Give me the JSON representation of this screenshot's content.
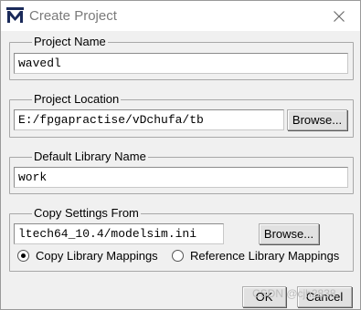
{
  "window": {
    "title": "Create Project"
  },
  "project_name": {
    "legend": "Project Name",
    "value": "wavedl"
  },
  "project_location": {
    "legend": "Project Location",
    "value": "E:/fpgapractise/vDchufa/tb",
    "browse_label": "Browse..."
  },
  "default_library": {
    "legend": "Default Library Name",
    "value": "work"
  },
  "copy_settings": {
    "legend": "Copy Settings From",
    "value": "ltech64_10.4/modelsim.ini",
    "browse_label": "Browse...",
    "options": [
      {
        "label": "Copy Library Mappings",
        "selected": true
      },
      {
        "label": "Reference Library Mappings",
        "selected": false
      }
    ]
  },
  "footer": {
    "ok_label": "OK",
    "cancel_label": "Cancel"
  },
  "watermark": "CSDN @cjh2838"
}
